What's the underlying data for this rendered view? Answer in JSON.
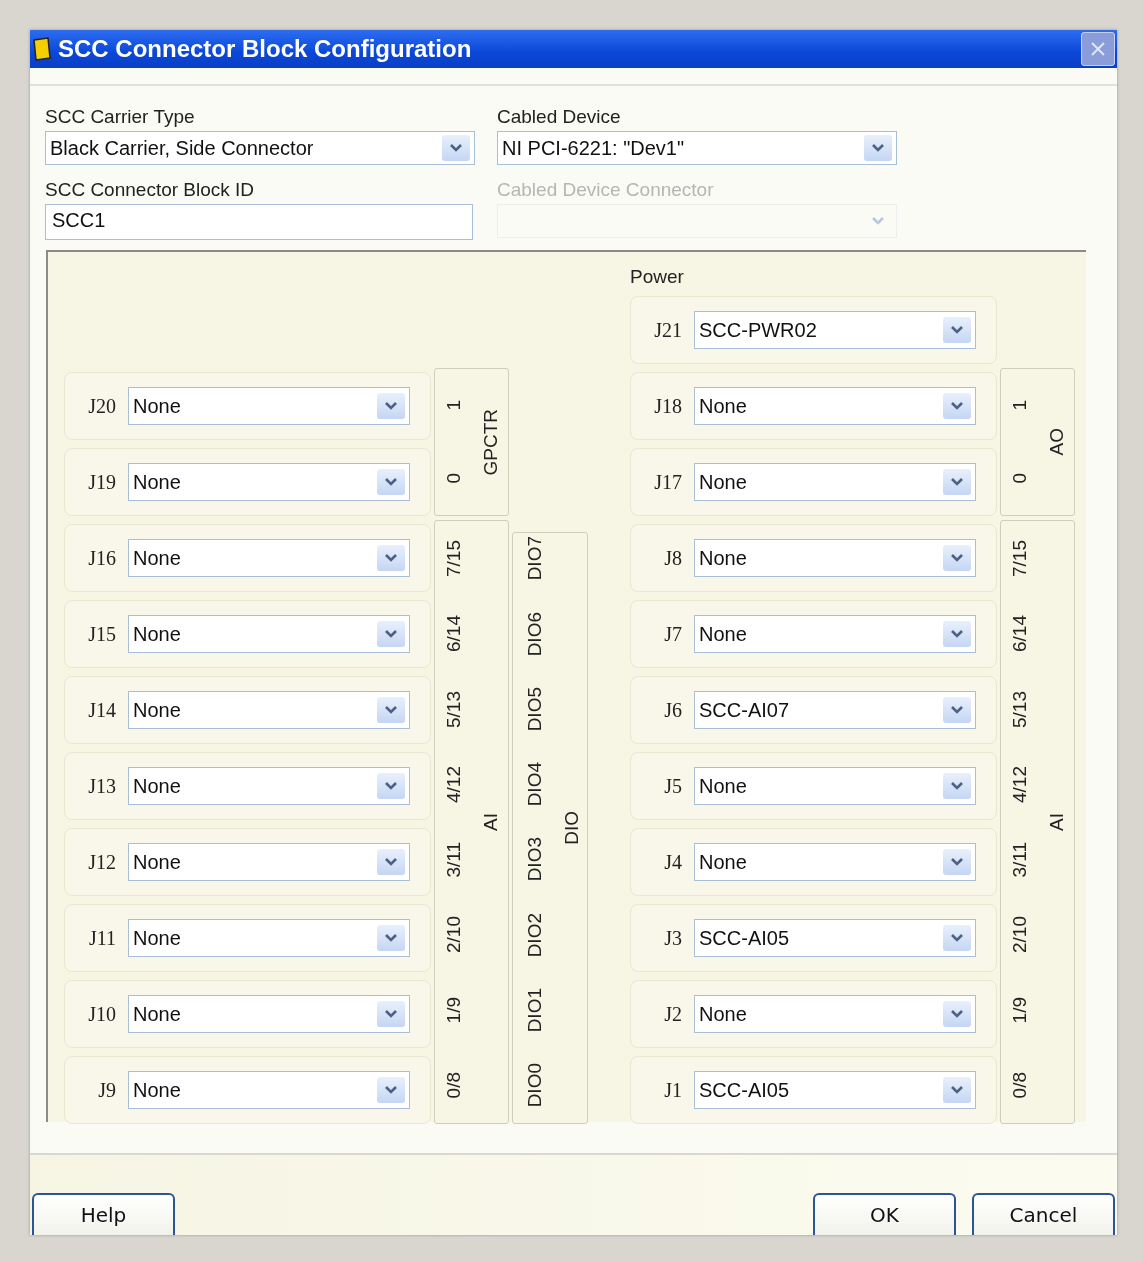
{
  "window": {
    "title": "SCC Connector Block Configuration"
  },
  "carrier_type": {
    "label": "SCC Carrier Type",
    "value": "Black Carrier, Side Connector"
  },
  "cabled_device": {
    "label": "Cabled Device",
    "value": "NI PCI-6221: \"Dev1\""
  },
  "block_id": {
    "label": "SCC Connector Block ID",
    "value": "SCC1"
  },
  "cabled_device_connector": {
    "label": "Cabled Device Connector",
    "disabled": true
  },
  "power": {
    "label": "Power",
    "slots": [
      {
        "connector": "J21",
        "value": "SCC-PWR02"
      }
    ]
  },
  "left_slots": [
    {
      "connector": "J20",
      "value": "None"
    },
    {
      "connector": "J19",
      "value": "None"
    },
    {
      "connector": "J16",
      "value": "None"
    },
    {
      "connector": "J15",
      "value": "None"
    },
    {
      "connector": "J14",
      "value": "None"
    },
    {
      "connector": "J13",
      "value": "None"
    },
    {
      "connector": "J12",
      "value": "None"
    },
    {
      "connector": "J11",
      "value": "None"
    },
    {
      "connector": "J10",
      "value": "None"
    },
    {
      "connector": "J9",
      "value": "None"
    }
  ],
  "left_groups": [
    {
      "title": "GPCTR",
      "channels": [
        "1",
        "0"
      ]
    },
    {
      "title": "AI",
      "channels": [
        "7/15",
        "6/14",
        "5/13",
        "4/12",
        "3/11",
        "2/10",
        "1/9",
        "0/8"
      ]
    }
  ],
  "dio_group": {
    "title": "DIO",
    "channels": [
      "DIO7",
      "DIO6",
      "DIO5",
      "DIO4",
      "DIO3",
      "DIO2",
      "DIO1",
      "DIO0"
    ]
  },
  "right_slots": [
    {
      "connector": "J18",
      "value": "None"
    },
    {
      "connector": "J17",
      "value": "None"
    },
    {
      "connector": "J8",
      "value": "None"
    },
    {
      "connector": "J7",
      "value": "None"
    },
    {
      "connector": "J6",
      "value": "SCC-AI07"
    },
    {
      "connector": "J5",
      "value": "None"
    },
    {
      "connector": "J4",
      "value": "None"
    },
    {
      "connector": "J3",
      "value": "SCC-AI05"
    },
    {
      "connector": "J2",
      "value": "None"
    },
    {
      "connector": "J1",
      "value": "SCC-AI05"
    }
  ],
  "right_groups": [
    {
      "title": "AO",
      "channels": [
        "1",
        "0"
      ]
    },
    {
      "title": "AI",
      "channels": [
        "7/15",
        "6/14",
        "5/13",
        "4/12",
        "3/11",
        "2/10",
        "1/9",
        "0/8"
      ]
    }
  ],
  "help_button": "Help",
  "buttons": [
    "OK",
    "Cancel"
  ]
}
